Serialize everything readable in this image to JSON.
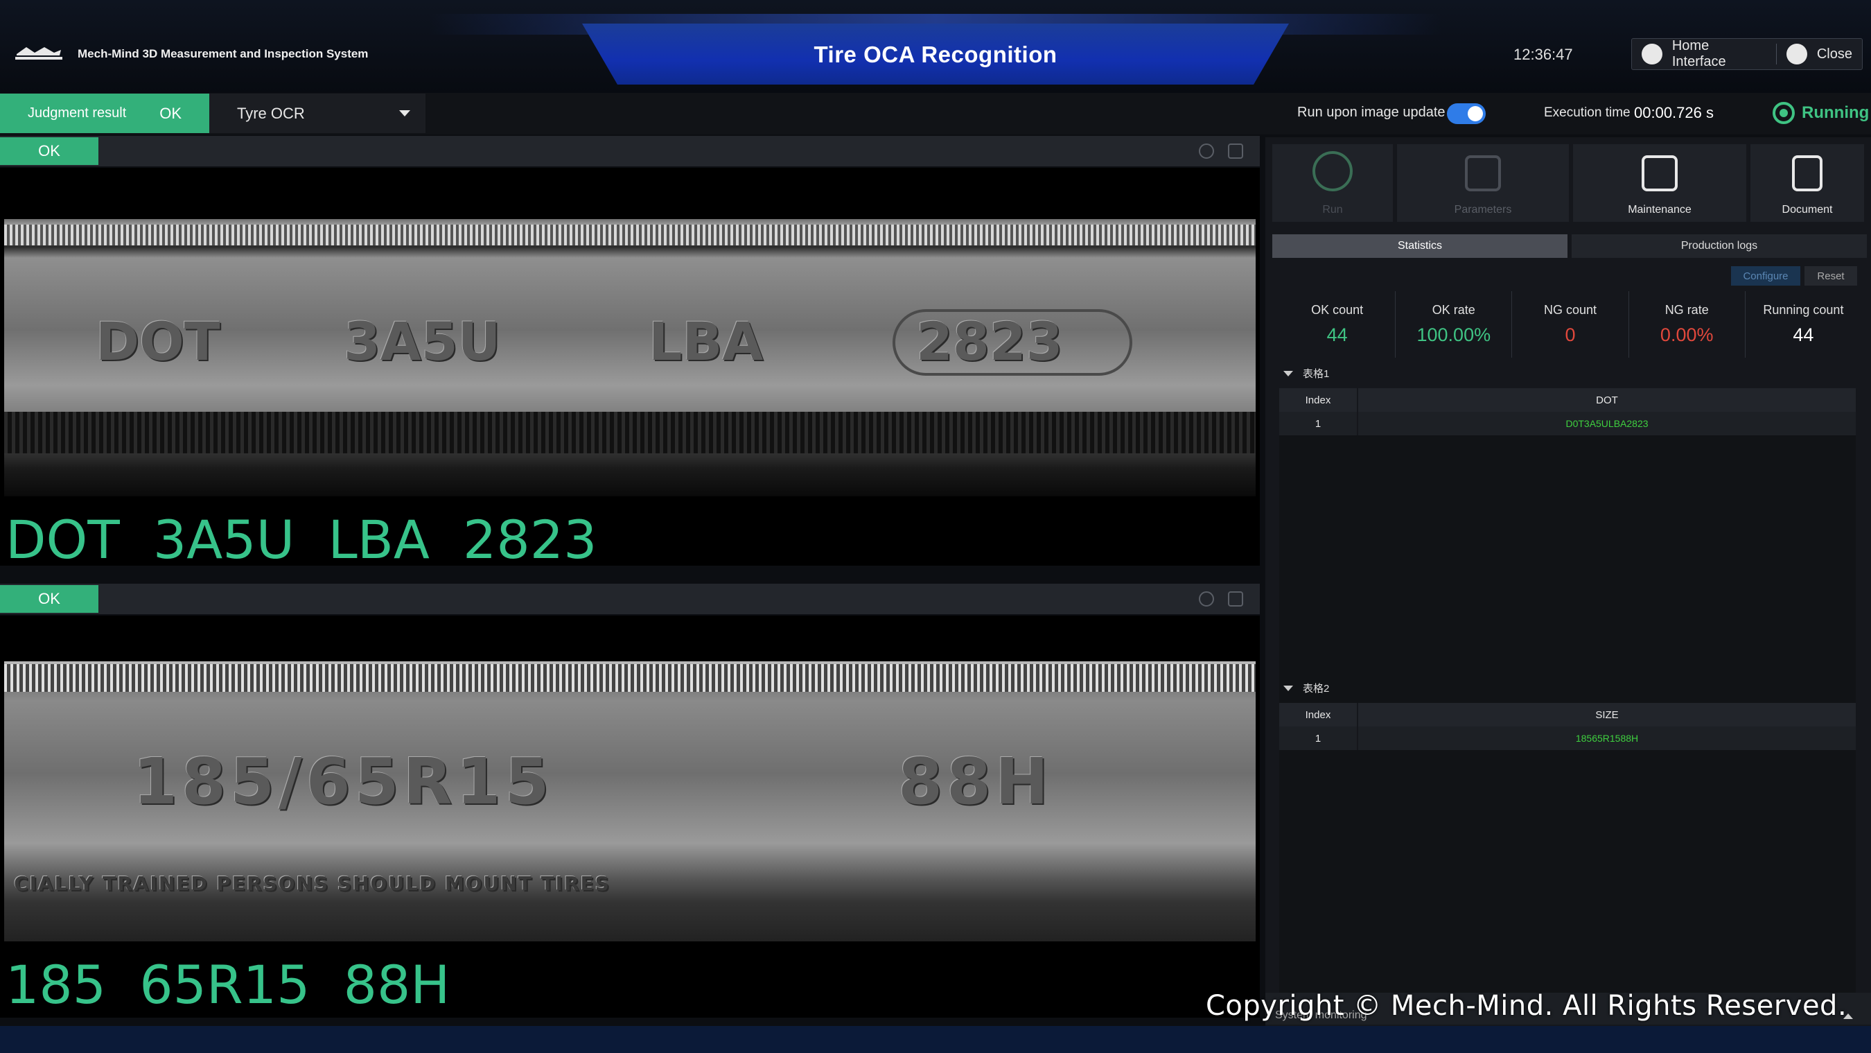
{
  "header": {
    "logo_text": "MECH MIND",
    "system_name": "Mech-Mind 3D Measurement and Inspection System",
    "app_title": "Tire OCA Recognition",
    "clock": "12:36:47",
    "home_label": "Home Interface",
    "close_label": "Close"
  },
  "toolbar": {
    "judgment_label": "Judgment result",
    "judgment_value": "OK",
    "project_select": "Tyre OCR",
    "run_on_update_label": "Run upon image update",
    "run_on_update": true,
    "exec_label": "Execution time",
    "exec_value": "00:00.726 s",
    "status": "Running"
  },
  "panels": [
    {
      "status": "OK",
      "tire_text": [
        "DOT",
        "3A5U",
        "LBA",
        "2823"
      ],
      "ocr_result": "DOT 3A5U LBA 2823"
    },
    {
      "status": "OK",
      "tire_text": [
        "185/65R15",
        "88H"
      ],
      "tire_subtext": "CIALLY TRAINED PERSONS SHOULD MOUNT TIRES",
      "ocr_result": "185 65R15 88H"
    }
  ],
  "tools": [
    {
      "label": "Run",
      "icon": "play-icon",
      "enabled": false
    },
    {
      "label": "Parameters",
      "icon": "parameters-icon",
      "enabled": false
    },
    {
      "label": "Maintenance",
      "icon": "maintenance-icon",
      "enabled": true
    },
    {
      "label": "Document",
      "icon": "document-icon",
      "enabled": true
    }
  ],
  "tabs": [
    "Statistics",
    "Production logs"
  ],
  "actions": {
    "configure": "Configure",
    "reset": "Reset"
  },
  "stats": [
    {
      "label": "OK count",
      "value": "44",
      "color": "#3fc383"
    },
    {
      "label": "OK rate",
      "value": "100.00%",
      "color": "#3fc383"
    },
    {
      "label": "NG count",
      "value": "0",
      "color": "#e0483c"
    },
    {
      "label": "NG rate",
      "value": "0.00%",
      "color": "#e0483c"
    },
    {
      "label": "Running count",
      "value": "44",
      "color": "#ffffff"
    }
  ],
  "tables": [
    {
      "title": "表格1",
      "headers": [
        "Index",
        "DOT"
      ],
      "rows": [
        [
          "1",
          "D0T3A5ULBA2823"
        ]
      ]
    },
    {
      "title": "表格2",
      "headers": [
        "Index",
        "SIZE"
      ],
      "rows": [
        [
          "1",
          "18565R1588H"
        ]
      ]
    }
  ],
  "footer": {
    "system_monitoring": "System monitoring",
    "copyright": "Copyright © Mech-Mind. All Rights Reserved."
  }
}
